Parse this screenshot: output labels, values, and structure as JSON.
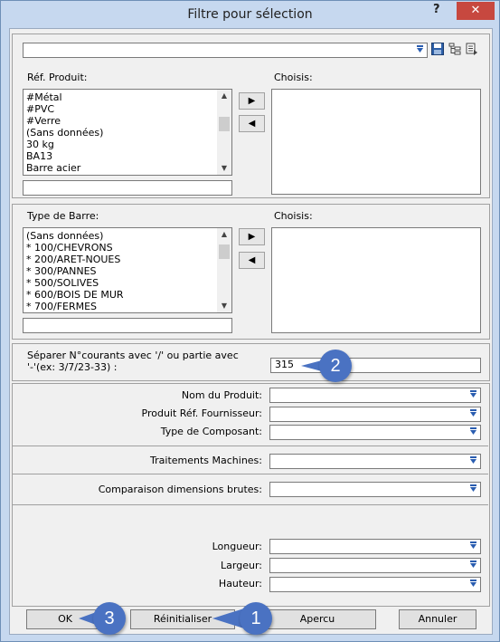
{
  "window": {
    "title": "Filtre pour sélection",
    "help_label": "?",
    "close_label": "✕"
  },
  "top_combo": {
    "value": ""
  },
  "ref_produit": {
    "label": "Réf. Produit:",
    "items": [
      "#Métal",
      "#PVC",
      "#Verre",
      "(Sans données)",
      "30 kg",
      "BA13",
      "Barre acier"
    ],
    "filter_value": "",
    "chosen_label": "Choisis:"
  },
  "type_barre": {
    "label": "Type de Barre:",
    "items": [
      "(Sans données)",
      "* 100/CHEVRONS",
      "* 200/ARET-NOUES",
      "* 300/PANNES",
      "* 500/SOLIVES",
      "* 600/BOIS DE MUR",
      "* 700/FERMES"
    ],
    "filter_value": "",
    "chosen_label": "Choisis:"
  },
  "transfer": {
    "add_symbol": "▶",
    "remove_symbol": "◀"
  },
  "separator_field": {
    "label_line1": "Séparer N°courants avec '/' ou partie avec",
    "label_line2": "'-'(ex: 3/7/23-33) :",
    "value": "315"
  },
  "fields": {
    "nom_produit": "Nom du Produit:",
    "produit_ref_fournisseur": "Produit Réf. Fournisseur:",
    "type_composant": "Type de Composant:",
    "traitements_machines": "Traitements Machines:",
    "comparaison": "Comparaison  dimensions brutes:",
    "longueur": "Longueur:",
    "largeur": "Largeur:",
    "hauteur": "Hauteur:"
  },
  "buttons": {
    "ok": "OK",
    "reinitialiser": "Réinitialiser",
    "apercu": "Apercu",
    "annuler": "Annuler"
  },
  "callouts": {
    "one": "1",
    "two": "2",
    "three": "3"
  },
  "colors": {
    "callout": "#4a72c2",
    "close_button": "#c7483f",
    "frame": "#c6d8ef",
    "dropdown_arrow": "#2a5db0"
  }
}
